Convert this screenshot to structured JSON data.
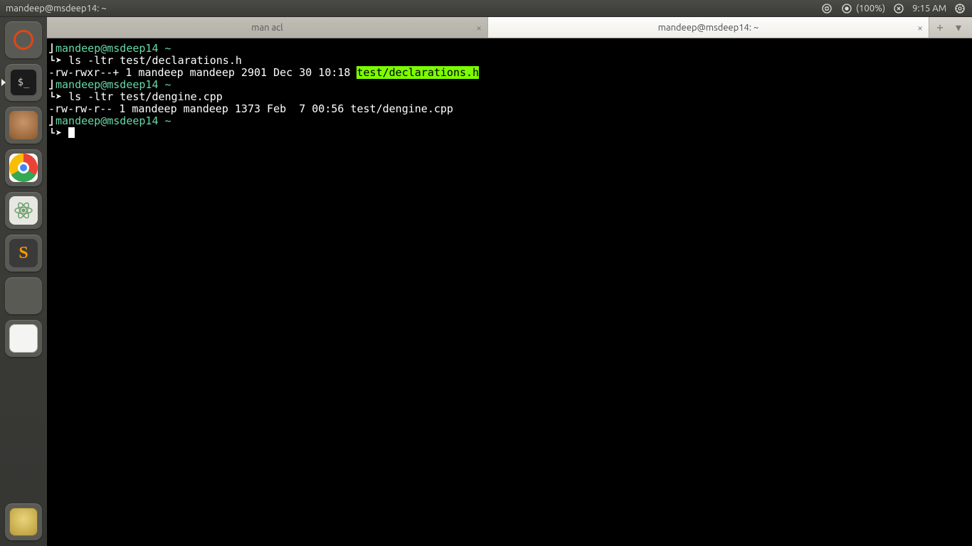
{
  "menubar": {
    "window_title": "mandeep@msdeep14: ~",
    "battery_pct": "(100%)",
    "time": "9:15 AM"
  },
  "launcher": {
    "items": [
      {
        "name": "ubuntu-dash"
      },
      {
        "name": "terminal"
      },
      {
        "name": "dbeaver"
      },
      {
        "name": "chrome"
      },
      {
        "name": "atom"
      },
      {
        "name": "sublime"
      },
      {
        "name": "code-blocks"
      },
      {
        "name": "nautilus"
      }
    ],
    "bottom": {
      "name": "trash"
    }
  },
  "tabs": [
    {
      "label": "man acl",
      "active": false
    },
    {
      "label": "mandeep@msdeep14: ~",
      "active": true
    }
  ],
  "prompt": {
    "user": "mandeep",
    "host": "msdeep14",
    "path": "~",
    "arrow": "➤"
  },
  "terminal": {
    "cmd1": "ls -ltr test/declarations.h",
    "out1_pre": "-rw-rwxr--+ 1 mandeep mandeep 2901 Dec 30 10:18 ",
    "out1_hl": "test/declarations.h",
    "cmd2": "ls -ltr test/dengine.cpp",
    "out2": "-rw-rw-r-- 1 mandeep mandeep 1373 Feb  7 00:56 test/dengine.cpp"
  }
}
